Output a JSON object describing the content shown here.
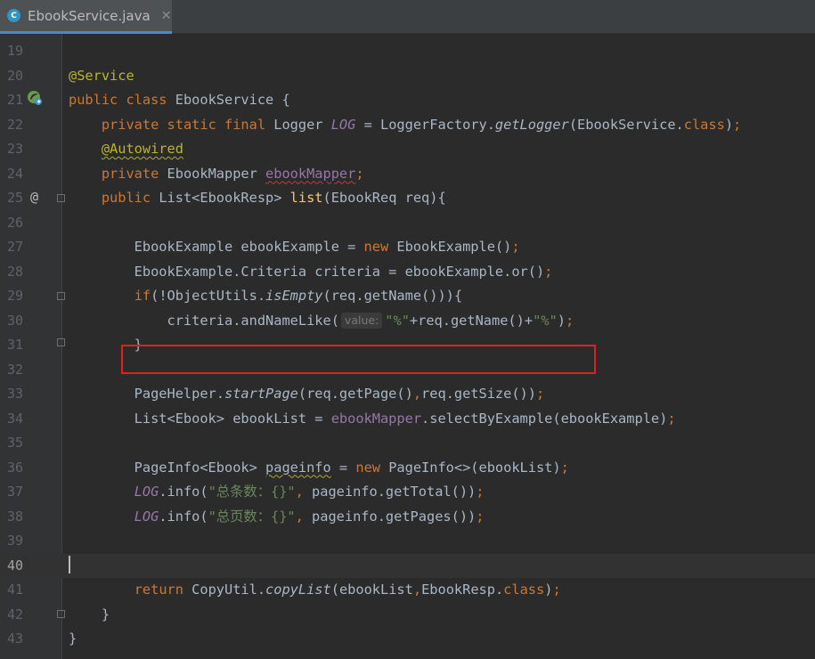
{
  "tab": {
    "icon_letter": "C",
    "title": "EbookService.java",
    "close": "✕"
  },
  "gutter": {
    "at_symbol": "@"
  },
  "hint": {
    "value_label": "value:"
  },
  "lines": [
    {
      "n": "19",
      "html": ""
    },
    {
      "n": "20",
      "html": "<span class=\"ann\">@Service</span>"
    },
    {
      "n": "21",
      "html": "<span class=\"kw\">public class </span>EbookService {"
    },
    {
      "n": "22",
      "html": "    <span class=\"kw\">private static final </span>Logger <span class=\"fld ital\">LOG</span> = LoggerFactory.<span class=\"ital\">getLogger</span>(EbookService.<span class=\"kw\">class</span>)<span class=\"kw\">;</span>"
    },
    {
      "n": "23",
      "html": "    <span class=\"ann squig\">@Autowired</span>"
    },
    {
      "n": "24",
      "html": "    <span class=\"kw\">private </span>EbookMapper <span class=\"fld squig-red\">ebookMapper</span><span class=\"kw\">;</span>"
    },
    {
      "n": "25",
      "html": "    <span class=\"kw\">public </span>List&lt;EbookResp&gt; <span class=\"mth\">list</span>(EbookReq req){"
    },
    {
      "n": "26",
      "html": ""
    },
    {
      "n": "27",
      "html": "        EbookExample ebookExample = <span class=\"kw\">new </span>EbookExample()<span class=\"kw\">;</span>"
    },
    {
      "n": "28",
      "html": "        EbookExample.Criteria criteria = ebookExample.or()<span class=\"kw\">;</span>"
    },
    {
      "n": "29",
      "html": "        <span class=\"kw\">if</span>(!ObjectUtils.<span class=\"ital\">isEmpty</span>(req.getName())){"
    },
    {
      "n": "30",
      "html": "            criteria.andNameLike(<span class=\"hint\" data-hint=\"1\"></span><span class=\"str\">\"%\"</span>+req.getName()+<span class=\"str\">\"%\"</span>)<span class=\"kw\">;</span>"
    },
    {
      "n": "31",
      "html": "        }"
    },
    {
      "n": "32",
      "html": ""
    },
    {
      "n": "33",
      "html": "        PageHelper.<span class=\"ital\">startPage</span>(req.getPage()<span class=\"kw\">,</span>req.getSize())<span class=\"kw\">;</span>"
    },
    {
      "n": "34",
      "html": "        List&lt;Ebook&gt; ebookList = <span class=\"fld\">ebookMapper</span>.selectByExample(ebookExample)<span class=\"kw\">;</span>"
    },
    {
      "n": "35",
      "html": ""
    },
    {
      "n": "36",
      "html": "        PageInfo&lt;Ebook&gt; <span class=\"squig\">pageinfo</span> = <span class=\"kw\">new </span>PageInfo&lt;&gt;(ebookList)<span class=\"kw\">;</span>"
    },
    {
      "n": "37",
      "html": "        <span class=\"fld ital\">LOG</span>.info(<span class=\"str\">\"总条数：{}\"</span><span class=\"kw\">, </span>pageinfo.getTotal())<span class=\"kw\">;</span>"
    },
    {
      "n": "38",
      "html": "        <span class=\"fld ital\">LOG</span>.info(<span class=\"str\">\"总页数：{}\"</span><span class=\"kw\">, </span>pageinfo.getPages())<span class=\"kw\">;</span>"
    },
    {
      "n": "39",
      "html": ""
    },
    {
      "n": "40",
      "html": ""
    },
    {
      "n": "41",
      "html": "        <span class=\"kw\">return </span>CopyUtil.<span class=\"ital\">copyList</span>(ebookList<span class=\"kw\">,</span>EbookResp.<span class=\"kw\">class</span>)<span class=\"kw\">;</span>"
    },
    {
      "n": "42",
      "html": "    }"
    },
    {
      "n": "43",
      "html": "}"
    }
  ],
  "current_line": "40"
}
